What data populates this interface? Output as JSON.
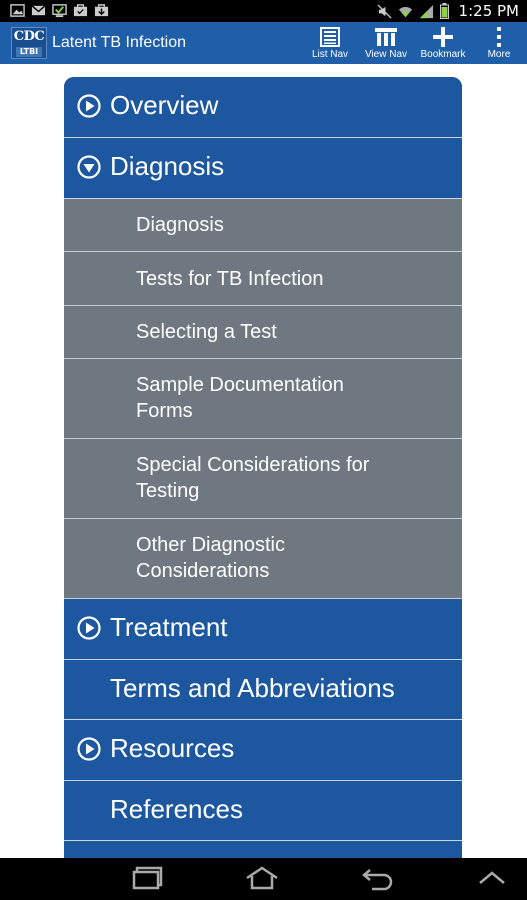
{
  "status_bar": {
    "time": "1:25 PM",
    "left_icons": [
      "picture-icon",
      "gmail-icon",
      "download-check-icon",
      "briefcase-icon",
      "bag-icon"
    ],
    "right_icons": [
      "mute-icon",
      "wifi-icon",
      "signal-icon",
      "battery-icon"
    ]
  },
  "app_bar": {
    "logo_top": "CDC",
    "logo_bottom": "LTBI",
    "title": "Latent TB Infection",
    "actions": [
      {
        "label": "List Nav",
        "icon": "list-icon"
      },
      {
        "label": "View Nav",
        "icon": "view-nav-icon"
      },
      {
        "label": "Bookmark",
        "icon": "plus-icon"
      },
      {
        "label": "More",
        "icon": "more-vertical-icon"
      }
    ]
  },
  "menu": {
    "items": [
      {
        "label": "Overview",
        "kind": "top",
        "icon": "play-circle-icon"
      },
      {
        "label": "Diagnosis",
        "kind": "top",
        "icon": "down-circle-icon"
      },
      {
        "label": "Diagnosis",
        "kind": "sub"
      },
      {
        "label": "Tests for TB Infection",
        "kind": "sub"
      },
      {
        "label": "Selecting a Test",
        "kind": "sub"
      },
      {
        "label": "Sample Documentation Forms",
        "kind": "sub"
      },
      {
        "label": "Special Considerations for Testing",
        "kind": "sub"
      },
      {
        "label": "Other Diagnostic Considerations",
        "kind": "sub"
      },
      {
        "label": "Treatment",
        "kind": "top",
        "icon": "play-circle-icon"
      },
      {
        "label": "Terms and Abbreviations",
        "kind": "top"
      },
      {
        "label": "Resources",
        "kind": "top",
        "icon": "play-circle-icon"
      },
      {
        "label": "References",
        "kind": "top"
      }
    ]
  },
  "nav_bar": {
    "buttons": [
      "recent-apps-icon",
      "home-icon",
      "back-icon",
      "menu-up-icon"
    ]
  },
  "colors": {
    "app_bar": "#1f5fa9",
    "top_item": "#1c57a0",
    "sub_item": "#6f7780"
  }
}
